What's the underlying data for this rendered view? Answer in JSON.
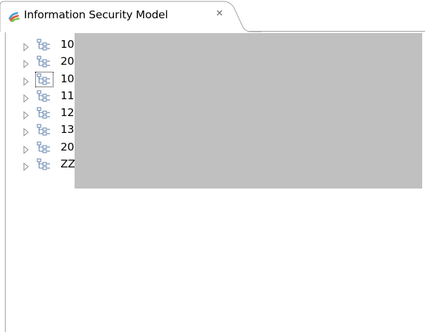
{
  "tab": {
    "title": "Information Security Model",
    "close_glyph": "✕",
    "icon": "model-icon"
  },
  "tree": {
    "items": [
      {
        "label": "10",
        "icon": "structure-icon",
        "expander": "collapsed-arrow-icon"
      },
      {
        "label": "20",
        "icon": "structure-icon",
        "expander": "collapsed-arrow-icon"
      },
      {
        "label": "10",
        "icon": "structure-icon",
        "expander": "collapsed-arrow-icon",
        "focused": true
      },
      {
        "label": "11",
        "icon": "structure-icon",
        "expander": "collapsed-arrow-icon"
      },
      {
        "label": "12",
        "icon": "structure-icon",
        "expander": "collapsed-arrow-icon"
      },
      {
        "label": "13",
        "icon": "structure-icon",
        "expander": "collapsed-arrow-icon"
      },
      {
        "label": "20",
        "icon": "structure-icon",
        "expander": "collapsed-arrow-icon"
      },
      {
        "label": "ZZ Vorlage Neues Projekt / Verfahren",
        "icon": "structure-icon",
        "expander": "collapsed-arrow-icon"
      }
    ]
  },
  "colors": {
    "redaction": "#c0c0c0",
    "border": "#a0a0a0",
    "background": "#ffffff"
  }
}
